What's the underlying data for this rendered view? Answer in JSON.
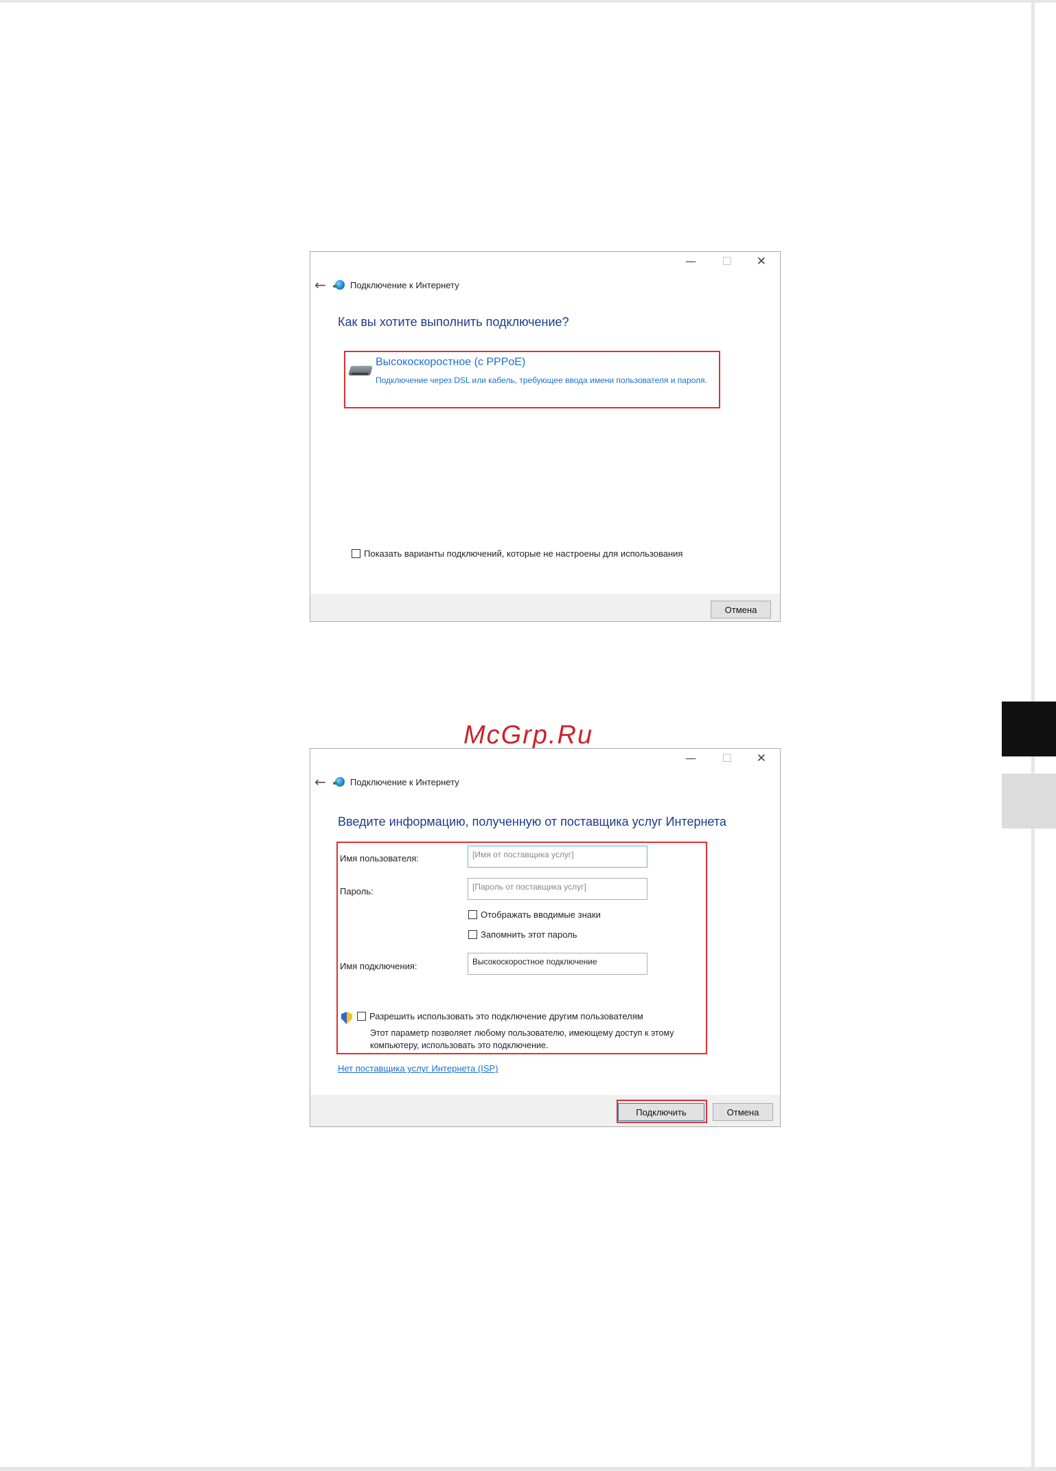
{
  "watermark": "McGrp.Ru",
  "window_controls": {
    "minimize": "—",
    "maximize": "☐",
    "close": "✕"
  },
  "dialog1": {
    "back_glyph": "←",
    "window_title": "Подключение к Интернету",
    "heading": "Как вы хотите выполнить подключение?",
    "option": {
      "title": "Высокоскоростное (с PPPoE)",
      "description": "Подключение через DSL или кабель, требующее ввода имени пользователя и пароля."
    },
    "show_all_label": "Показать варианты подключений, которые не настроены для использования",
    "cancel_label": "Отмена"
  },
  "dialog2": {
    "back_glyph": "←",
    "window_title": "Подключение к Интернету",
    "heading": "Введите информацию, полученную от поставщика услуг Интернета",
    "username_label": "Имя пользователя:",
    "username_placeholder": "[Имя от поставщика услуг]",
    "password_label": "Пароль:",
    "password_placeholder": "[Пароль от поставщика услуг]",
    "show_chars_label": "Отображать вводимые знаки",
    "remember_label": "Запомнить этот пароль",
    "connection_name_label": "Имя подключения:",
    "connection_name_value": "Высокоскоростное подключение",
    "allow_others_label": "Разрешить использовать это подключение другим пользователям",
    "allow_others_desc": "Этот параметр позволяет любому пользователю, имеющему доступ к этому компьютеру, использовать это подключение.",
    "no_isp_link": "Нет поставщика услуг Интернета (ISP)",
    "connect_label": "Подключить",
    "cancel_label": "Отмена"
  },
  "colors": {
    "highlight": "#e03030",
    "heading": "#1b3c8c",
    "link": "#1a6fd0"
  }
}
